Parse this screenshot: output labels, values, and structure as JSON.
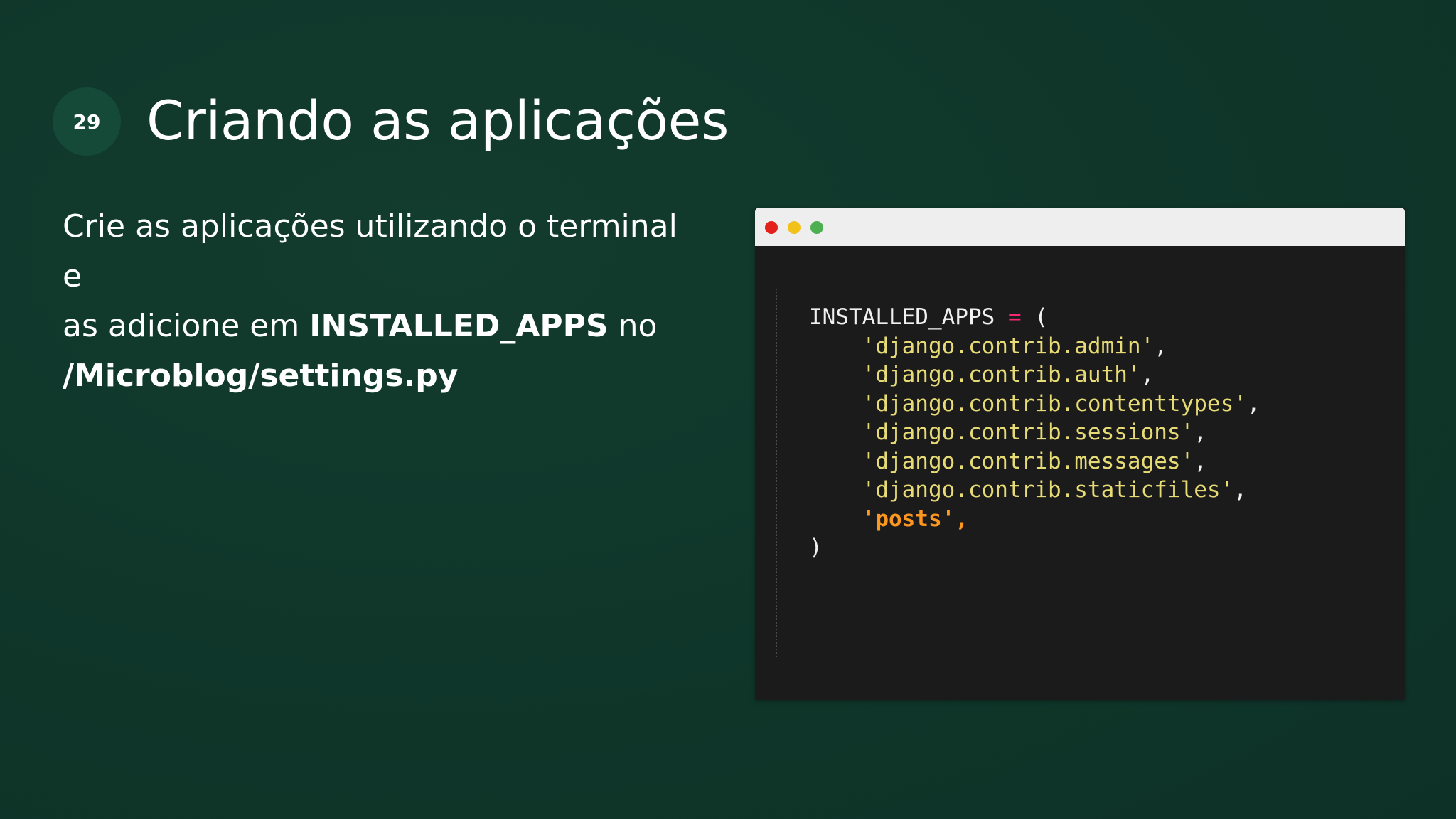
{
  "slide": {
    "number": "29",
    "title": "Criando as aplicações"
  },
  "body": {
    "line1": "Crie as aplicações utilizando o terminal e",
    "line2_prefix": "as adicione em ",
    "line2_bold": "INSTALLED_APPS",
    "line2_suffix": " no",
    "line3_bold": "/Microblog/settings.py"
  },
  "code_window": {
    "window_controls": [
      "close-dot",
      "minimize-dot",
      "maximize-dot"
    ],
    "colors": {
      "close": "#e3201b",
      "minimize": "#f2c21b",
      "maximize": "#4caf50",
      "string": "#e6db74",
      "highlight": "#fd971f",
      "operator": "#f92672"
    },
    "code": {
      "var_name": "INSTALLED_APPS",
      "operator": "=",
      "open_paren": "(",
      "apps": [
        "'django.contrib.admin'",
        "'django.contrib.auth'",
        "'django.contrib.contenttypes'",
        "'django.contrib.sessions'",
        "'django.contrib.messages'",
        "'django.contrib.staticfiles'"
      ],
      "new_app": "'posts'",
      "separator": ",",
      "close_paren": ")"
    }
  }
}
